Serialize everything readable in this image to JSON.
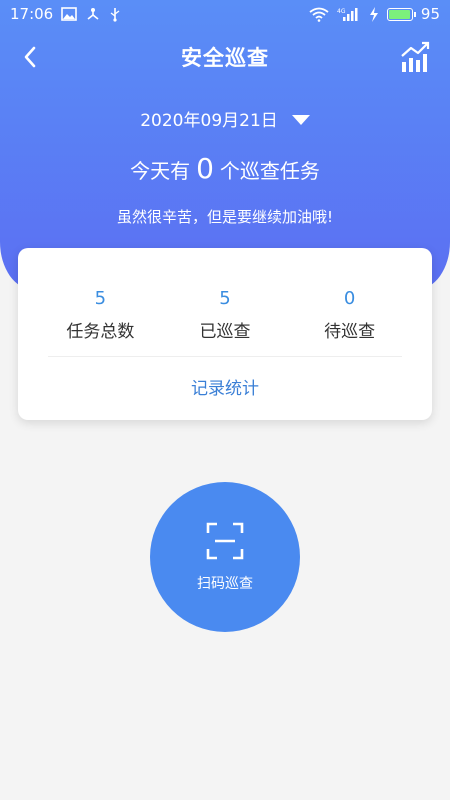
{
  "status_bar": {
    "time": "17:06",
    "battery_level": "95",
    "left_icons": [
      "image-icon",
      "usb-share-icon",
      "usb-icon"
    ],
    "right_icons": [
      "wifi-icon",
      "4g-signal-icon",
      "charging-icon",
      "battery-icon"
    ]
  },
  "nav": {
    "title": "安全巡查",
    "back_icon": "chevron-left-icon",
    "stats_icon": "chart-trend-icon"
  },
  "header": {
    "date": "2020年09月21日",
    "task_prefix": "今天有",
    "task_count": "0",
    "task_suffix": "个巡查任务",
    "encouragement": "虽然很辛苦，但是要继续加油哦!"
  },
  "summary": {
    "stats": [
      {
        "value": "5",
        "label": "任务总数"
      },
      {
        "value": "5",
        "label": "已巡查"
      },
      {
        "value": "0",
        "label": "待巡查"
      }
    ],
    "records_link": "记录统计"
  },
  "scan": {
    "label": "扫码巡查",
    "icon": "scan-icon"
  },
  "colors": {
    "header_gradient_top": "#5a8ef7",
    "header_gradient_bottom": "#5b6ff2",
    "accent": "#4a8af0",
    "stat_value": "#3a8de0",
    "background": "#f4f4f4"
  }
}
